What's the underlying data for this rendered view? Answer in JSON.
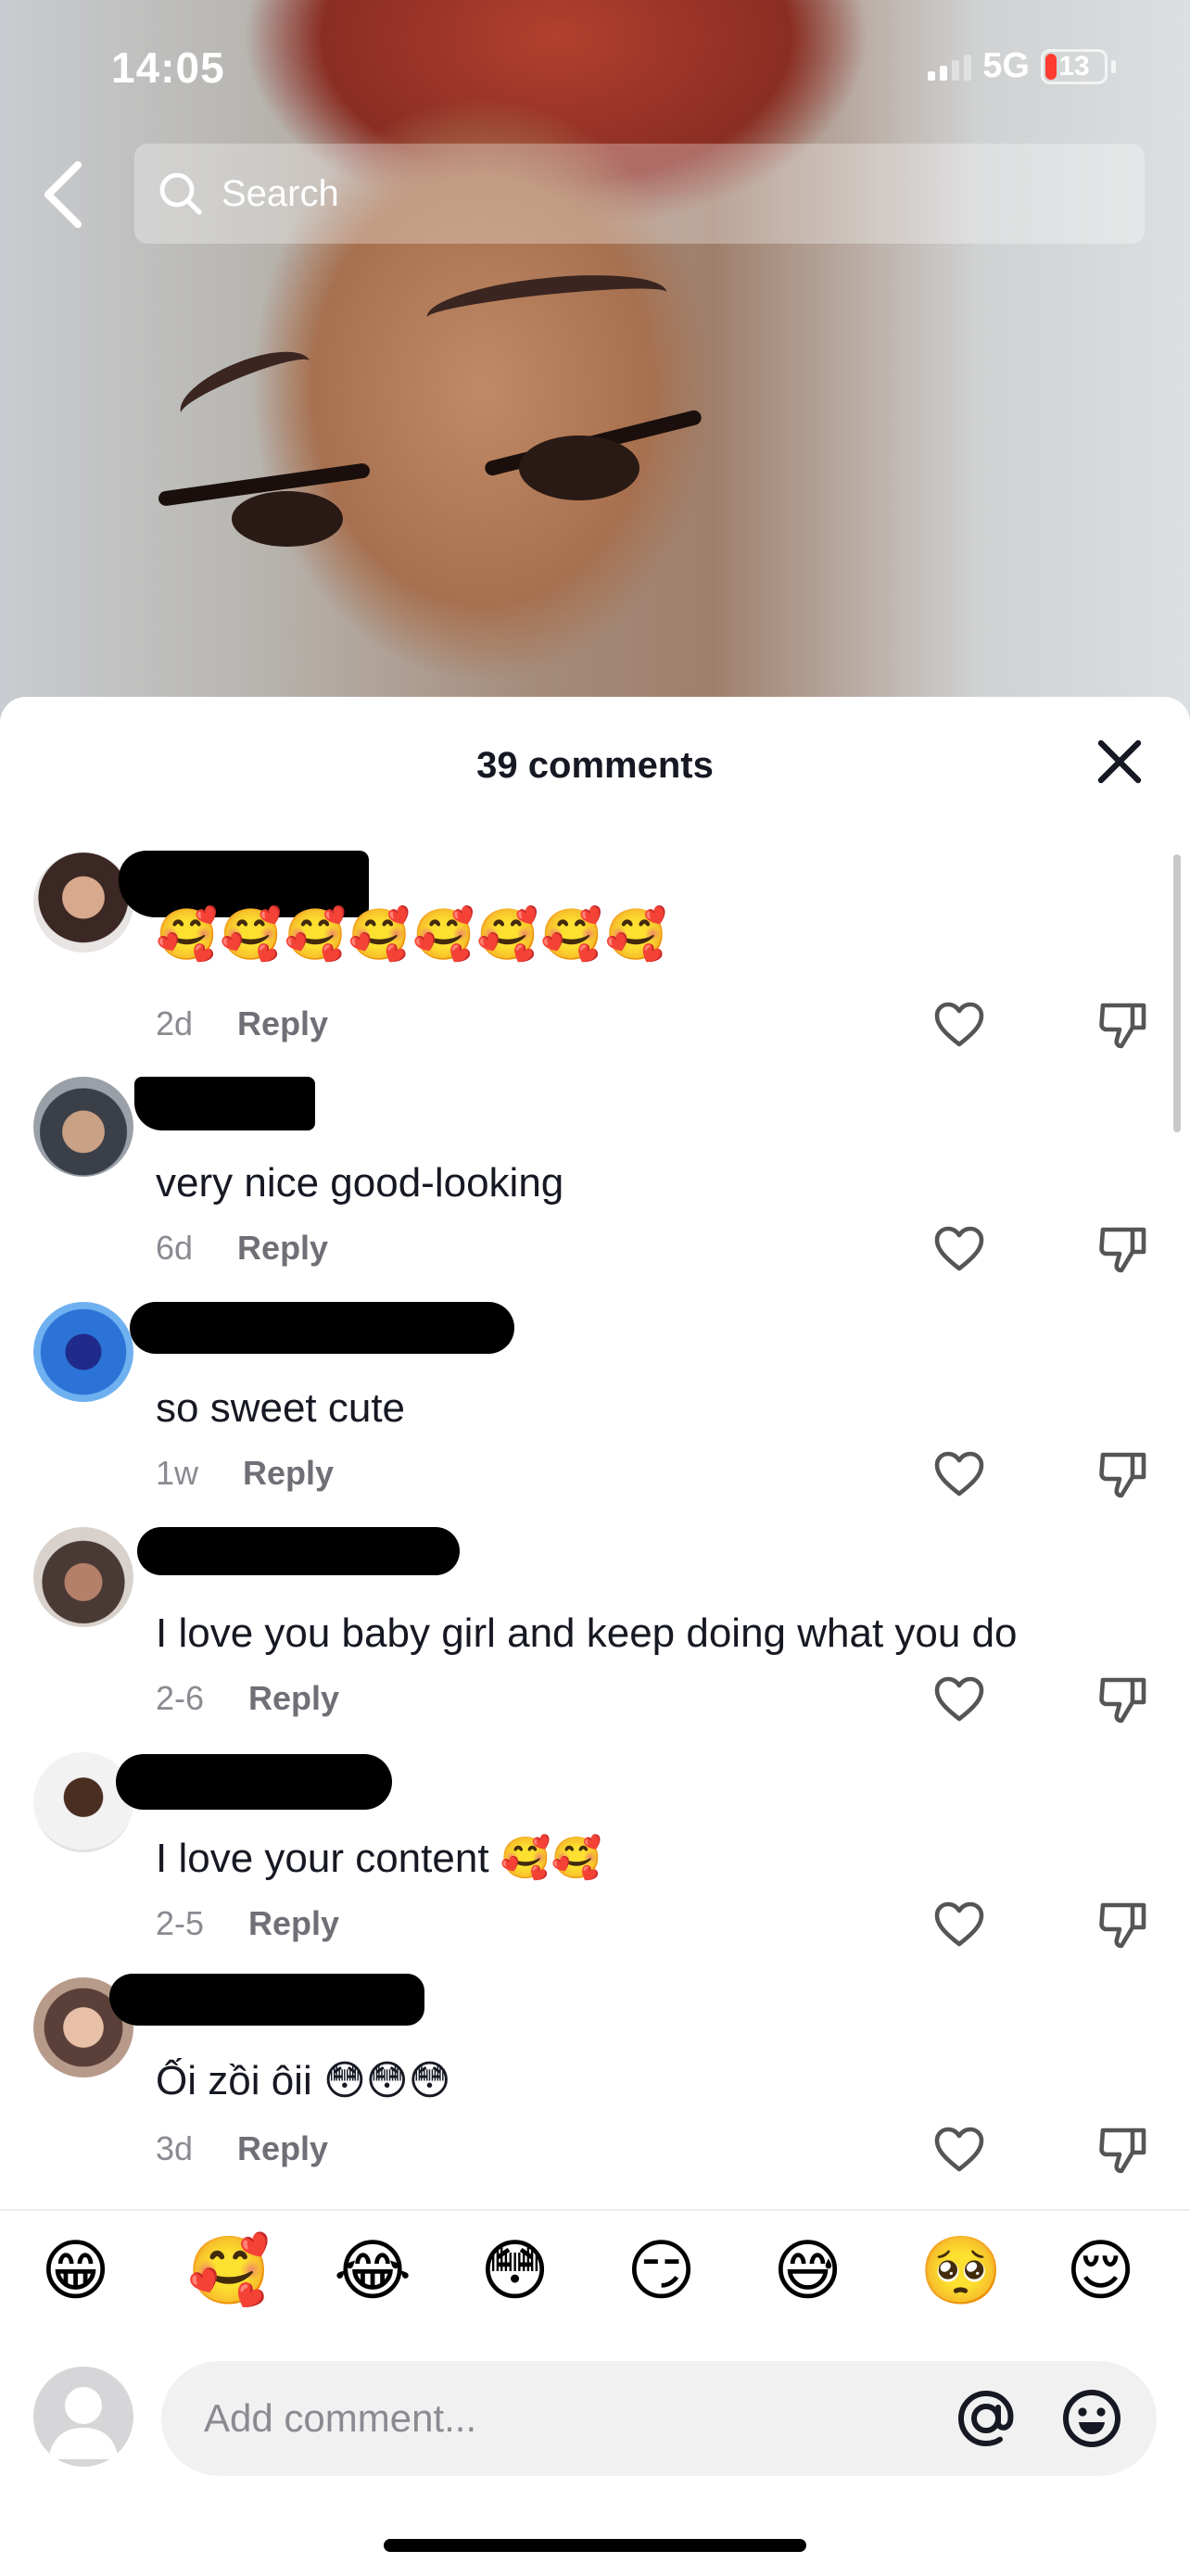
{
  "status": {
    "time": "14:05",
    "network": "5G",
    "battery": "13"
  },
  "search": {
    "placeholder": "Search"
  },
  "sheet": {
    "title": "39 comments"
  },
  "comments": [
    {
      "text": "🥰🥰🥰🥰🥰🥰🥰🥰",
      "age": "2d",
      "reply": "Reply"
    },
    {
      "text": "very nice good-looking",
      "age": "6d",
      "reply": "Reply"
    },
    {
      "text": "so sweet cute",
      "age": "1w",
      "reply": "Reply"
    },
    {
      "text": "I love you baby girl and keep doing what you do",
      "age": "2-6",
      "reply": "Reply"
    },
    {
      "text": "I love your content 🥰🥰",
      "age": "2-5",
      "reply": "Reply"
    },
    {
      "text": "Ối zồi ôii 😳😳😳",
      "age": "3d",
      "reply": "Reply"
    }
  ],
  "emoji_bar": [
    "😁",
    "🥰",
    "😂",
    "😳",
    "😏",
    "😅",
    "🥺",
    "😌"
  ],
  "composer": {
    "placeholder": "Add comment..."
  },
  "icons": {
    "back": "chevron-left-icon",
    "search": "search-icon",
    "close": "close-icon",
    "like": "heart-outline-icon",
    "dislike": "thumbs-down-icon",
    "mention": "at-sign-icon",
    "emoji": "smiley-icon"
  }
}
